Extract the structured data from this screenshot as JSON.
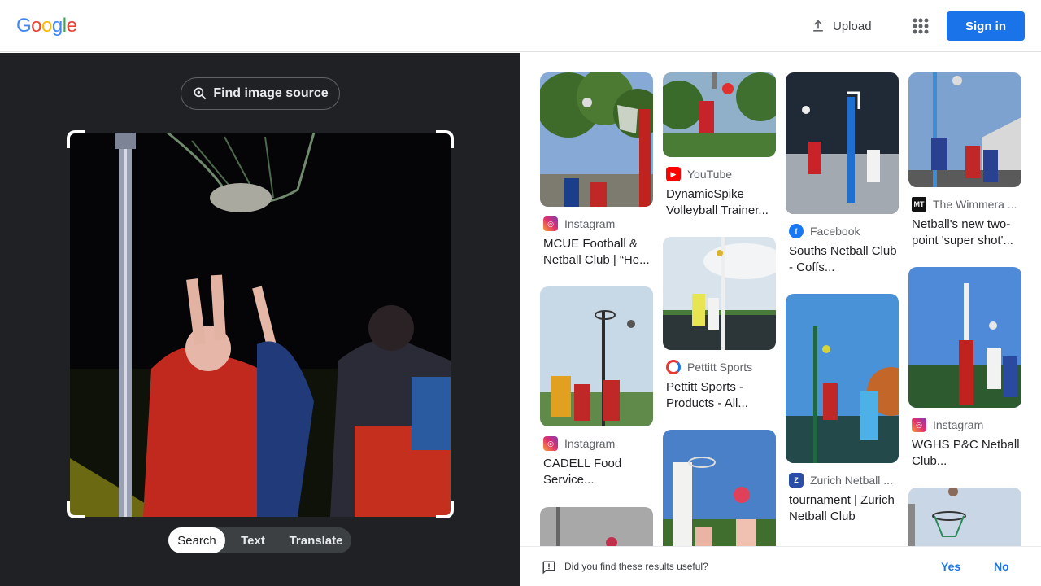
{
  "header": {
    "logo": [
      "G",
      "o",
      "o",
      "g",
      "l",
      "e"
    ],
    "logo_colors": [
      "#4285f4",
      "#ea4335",
      "#fbbc05",
      "#4285f4",
      "#34a853",
      "#ea4335"
    ],
    "upload_label": "Upload",
    "sign_in_label": "Sign in"
  },
  "left_pane": {
    "find_source_label": "Find image source",
    "modes": [
      "Search",
      "Text",
      "Translate"
    ],
    "active_mode": "Search"
  },
  "results": [
    {
      "source": "Instagram",
      "source_icon": "instagram-icon",
      "title": "MCUE Football & Netball Club | “He..."
    },
    {
      "source": "YouTube",
      "source_icon": "youtube-icon",
      "title": "DynamicSpike Volleyball Trainer..."
    },
    {
      "source": "Facebook",
      "source_icon": "facebook-icon",
      "title": "Souths Netball Club - Coffs..."
    },
    {
      "source": "The Wimmera ...",
      "source_icon": "wimmera-mt-icon",
      "title": "Netball's new two-point 'super shot'..."
    },
    {
      "source": "Instagram",
      "source_icon": "instagram-icon",
      "title": "CADELL Food Service..."
    },
    {
      "source": "Pettitt Sports",
      "source_icon": "pettitt-icon",
      "title": "Pettitt Sports - Products - All..."
    },
    {
      "source": "Zurich Netball ...",
      "source_icon": "zurich-icon",
      "title": "tournament | Zurich Netball Club"
    },
    {
      "source": "Instagram",
      "source_icon": "instagram-icon",
      "title": "WGHS P&C Netball Club..."
    }
  ],
  "feedback": {
    "question": "Did you find these results useful?",
    "yes_label": "Yes",
    "no_label": "No"
  },
  "colors": {
    "accent": "#1a73e8",
    "dark_bg": "#202124"
  }
}
